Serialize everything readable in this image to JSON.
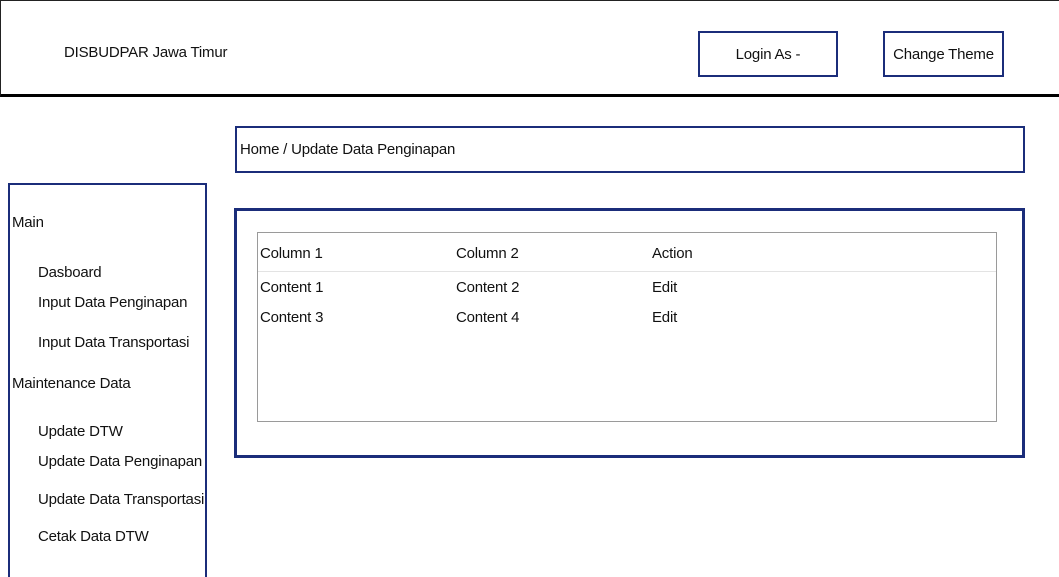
{
  "header": {
    "title": "DISBUDPAR Jawa Timur",
    "login_label": "Login As -",
    "theme_label": "Change Theme"
  },
  "breadcrumb": {
    "text": "Home / Update Data Penginapan"
  },
  "sidebar": {
    "sections": [
      {
        "label": "Main",
        "items": [
          "Dasboard",
          "Input Data Penginapan",
          "Input Data Transportasi"
        ]
      },
      {
        "label": "Maintenance Data",
        "items": [
          "Update DTW",
          "Update Data Penginapan",
          "Update Data Transportasi",
          "Cetak Data DTW"
        ]
      }
    ]
  },
  "table": {
    "columns": [
      "Column 1",
      "Column 2",
      "Action"
    ],
    "rows": [
      [
        "Content 1",
        "Content 2",
        "Edit"
      ],
      [
        "Content 3",
        "Content 4",
        "Edit"
      ]
    ]
  },
  "colors": {
    "accent": "#1b2d7a",
    "header_rule": "#000000",
    "table_border": "#9a9a9a"
  }
}
